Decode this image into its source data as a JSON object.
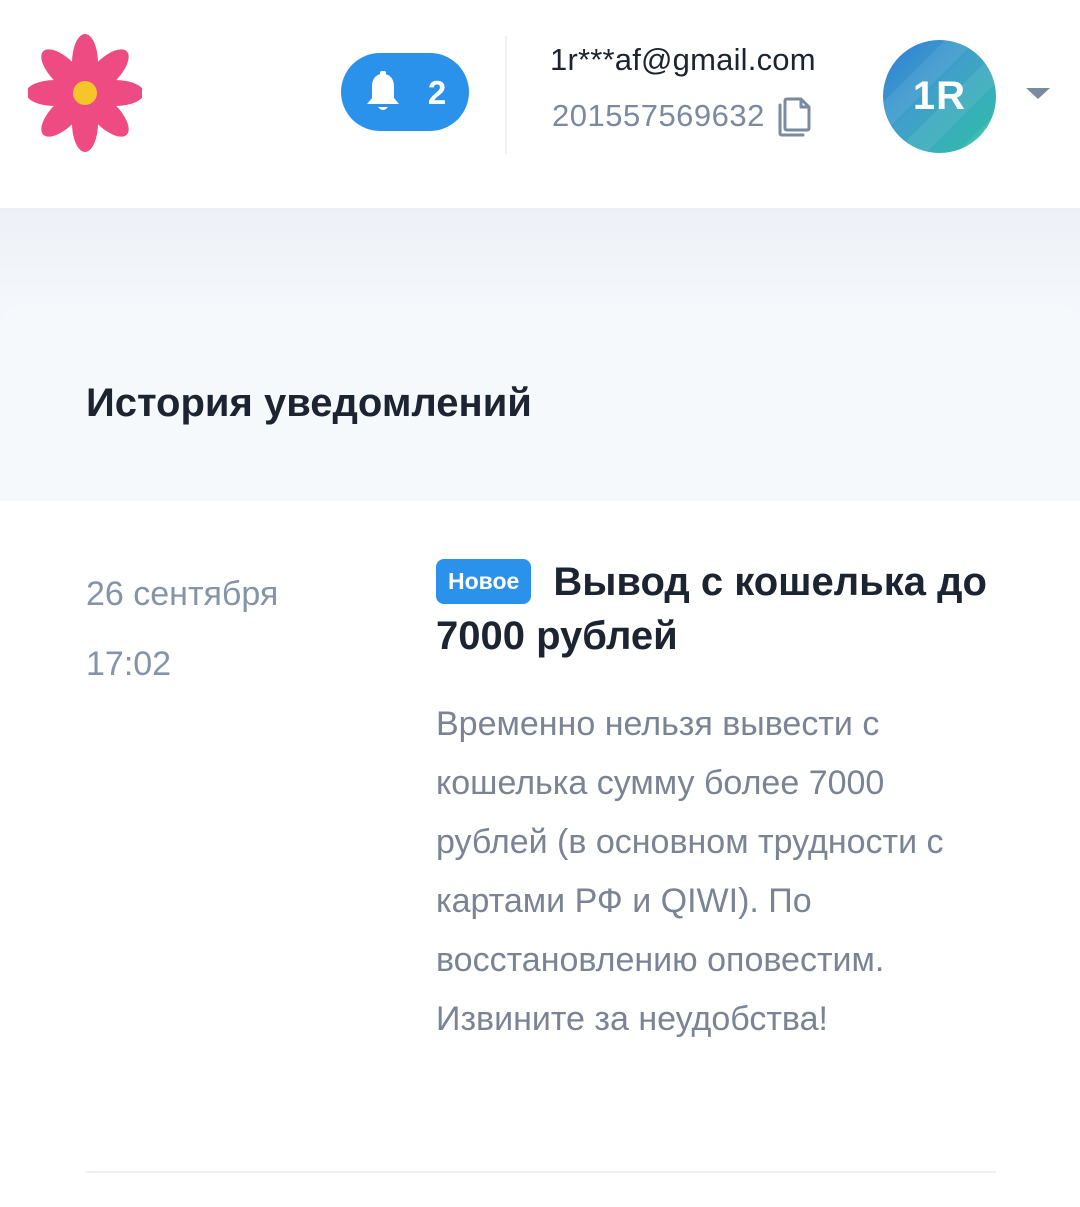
{
  "header": {
    "logo_icon": "flower-logo-icon",
    "notifications": {
      "icon": "bell-icon",
      "count": "2"
    },
    "account": {
      "email": "1r***af@gmail.com",
      "id": "201557569632",
      "copy_icon": "copy-icon"
    },
    "avatar": {
      "initials": "1R"
    },
    "menu_icon": "chevron-down-icon"
  },
  "history": {
    "title": "История уведомлений",
    "items": [
      {
        "date": "26 сентября",
        "time": "17:02",
        "badge": "Новое",
        "title": "Вывод с кошелька до 7000 рублей",
        "text": "Временно нельзя вывести с кошелька сумму более 7000 рублей (в основном трудности с картами РФ и QIWI). По восстановлению оповестим. Извините за неудобства!"
      }
    ]
  },
  "colors": {
    "accent": "#2b92eb",
    "logo_petal": "#ef4b83",
    "logo_center": "#f6c52a",
    "text_primary": "#1b2430",
    "text_muted": "#7a8aa0"
  }
}
